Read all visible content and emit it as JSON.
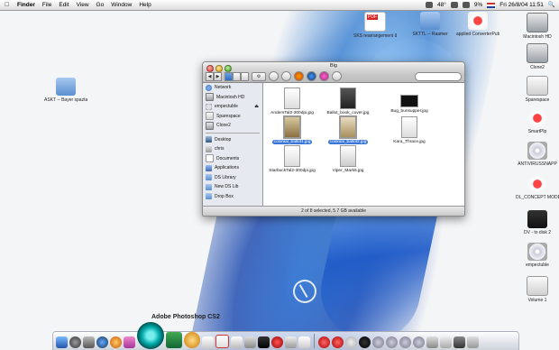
{
  "menubar": {
    "apple": "",
    "items": [
      "Finder",
      "File",
      "Edit",
      "View",
      "Go",
      "Window",
      "Help"
    ],
    "right": {
      "temp": "48°",
      "battery": "9%",
      "datetime": "Fri 26/8/04  11:51"
    }
  },
  "window": {
    "title": "Big",
    "search_placeholder": "",
    "sidebar": {
      "places": [
        "Network",
        "Macintosh HD",
        "empectuble",
        "Sparespace",
        "Clone2"
      ],
      "favorites": [
        "Desktop",
        "chris",
        "Documents",
        "Applications",
        "DS Library",
        "New DS Lib",
        "Drop Box"
      ]
    },
    "files": [
      {
        "name": "AndersTal2-300dpi.jpg",
        "selected": false
      },
      {
        "name": "Ballot_book_cover.jpg",
        "selected": false
      },
      {
        "name": "Bug_bunsupper.jpg",
        "selected": false
      },
      {
        "name": "colonial_ballot1.jpg",
        "selected": true
      },
      {
        "name": "colonial_ballot2.jpg",
        "selected": true
      },
      {
        "name": "Kara_Thrace.jpg",
        "selected": false
      },
      {
        "name": "StarbuckTal2-300dpi.jpg",
        "selected": false
      },
      {
        "name": "Viper_Mark6.jpg",
        "selected": false
      }
    ],
    "status": "2 of 8 selected, 5.7 GB available"
  },
  "desktop_icons_left": [
    {
      "label": "ASKT -- Bayer spaztar"
    }
  ],
  "desktop_icons_top": [
    {
      "label": "SKS rearrangement & cleared comp"
    },
    {
      "label": "SKTTL -- Raamer"
    },
    {
      "label": "applied ConverterPublish"
    }
  ],
  "desktop_icons_right": [
    {
      "label": "Macintosh HD"
    },
    {
      "label": "Clone2"
    },
    {
      "label": "Sparespace"
    },
    {
      "label": "SmartPlp"
    },
    {
      "label": "ANTIVIRUSSNAPP"
    },
    {
      "label": "DL_CONCEPT MODE"
    },
    {
      "label": "DV - to disk 2"
    },
    {
      "label": "empectuble"
    },
    {
      "label": "Volume 1"
    }
  ],
  "dock": {
    "hover_label": "Adobe Photoshop CS2"
  }
}
